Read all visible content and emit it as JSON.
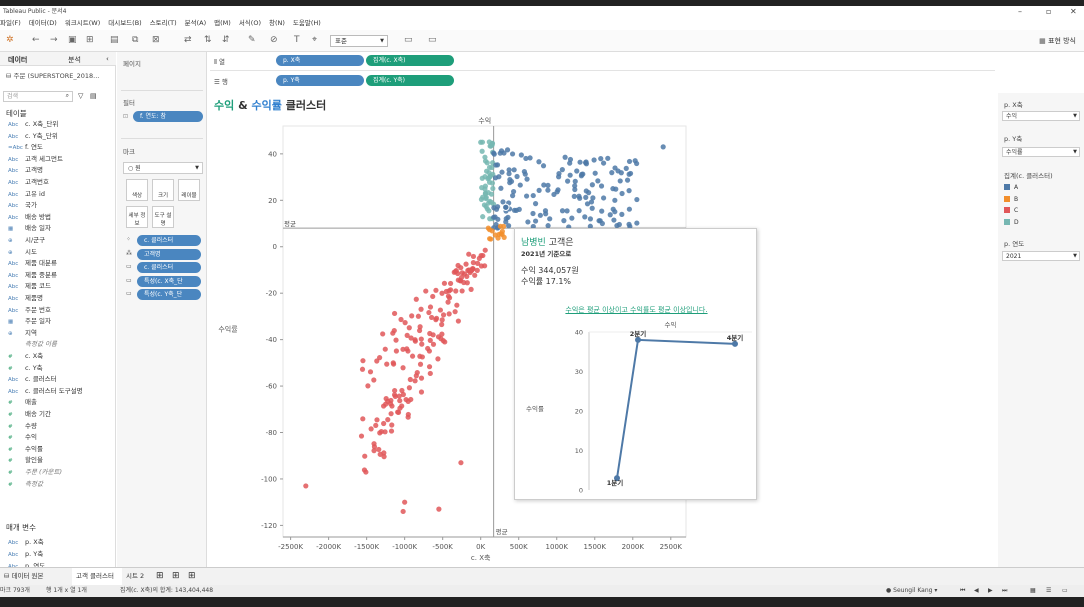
{
  "window": {
    "title": "Tableau Public - 문서4"
  },
  "menu": [
    "파일(F)",
    "데이터(D)",
    "워크시트(W)",
    "대시보드(B)",
    "스토리(T)",
    "분석(A)",
    "맵(M)",
    "서식(O)",
    "창(N)",
    "도움말(H)"
  ],
  "toolbar": {
    "dropdown_value": "표준",
    "show_me": "표현 방식"
  },
  "sidebar": {
    "tab_data": "데이터",
    "tab_analysis": "분석",
    "datasource": "주문 (SUPERSTORE_2018...",
    "search_placeholder": "검색",
    "tables_header": "테이블",
    "fields": [
      {
        "type": "Abc",
        "name": "c. X축_단위"
      },
      {
        "type": "Abc",
        "name": "c. Y축_단위"
      },
      {
        "type": "=Abc",
        "name": "f. 연도"
      },
      {
        "type": "Abc",
        "name": "고객 세그먼트"
      },
      {
        "type": "Abc",
        "name": "고객명"
      },
      {
        "type": "Abc",
        "name": "고객번호"
      },
      {
        "type": "Abc",
        "name": "고유 id"
      },
      {
        "type": "Abc",
        "name": "국가"
      },
      {
        "type": "Abc",
        "name": "배송 방법"
      },
      {
        "type": "▦",
        "name": "배송 일자"
      },
      {
        "type": "⊕",
        "name": "시/군구"
      },
      {
        "type": "⊕",
        "name": "시도"
      },
      {
        "type": "Abc",
        "name": "제품 대분류"
      },
      {
        "type": "Abc",
        "name": "제품 중분류"
      },
      {
        "type": "Abc",
        "name": "제품 코드"
      },
      {
        "type": "Abc",
        "name": "제품명"
      },
      {
        "type": "Abc",
        "name": "주문 번호"
      },
      {
        "type": "▦",
        "name": "주문 일자"
      },
      {
        "type": "⊕",
        "name": "지역"
      },
      {
        "type": "",
        "name": "측정값 이름"
      },
      {
        "type": "#",
        "name": "c. X축"
      },
      {
        "type": "#",
        "name": "c. Y축"
      },
      {
        "type": "Abc",
        "name": "c. 클러스터"
      },
      {
        "type": "Abc",
        "name": "c. 클러스터 도구설명"
      },
      {
        "type": "#",
        "name": "매출"
      },
      {
        "type": "#",
        "name": "배송 기간"
      },
      {
        "type": "#",
        "name": "수량"
      },
      {
        "type": "#",
        "name": "수익"
      },
      {
        "type": "#",
        "name": "수익률"
      },
      {
        "type": "#",
        "name": "할인율"
      },
      {
        "type": "#",
        "name": "주문 (카운트)"
      },
      {
        "type": "#",
        "name": "측정값"
      }
    ],
    "params_header": "매개 변수",
    "params": [
      {
        "type": "Abc",
        "name": "p. X축"
      },
      {
        "type": "Abc",
        "name": "p. Y축"
      },
      {
        "type": "Abc",
        "name": "p. 연도"
      }
    ]
  },
  "cards": {
    "pages": "페이지",
    "filters": "필터",
    "filter_pill": "f. 연도: 참",
    "marks": "마크",
    "mark_type": "원",
    "btn_color": "색상",
    "btn_size": "크기",
    "btn_label": "레이블",
    "btn_detail": "세부 정보",
    "btn_tooltip": "도구 설명",
    "mark_pills": [
      "c. 클러스터",
      "고객명",
      "c. 클러스터",
      "특성(c. X축_단",
      "특성(c. Y축_단"
    ]
  },
  "shelves": {
    "columns_label": "열",
    "rows_label": "행",
    "columns": [
      "p. X축",
      "집계(c. X축)"
    ],
    "rows": [
      "p. Y축",
      "집계(c. Y축)"
    ]
  },
  "chart_title": {
    "part1": "수익",
    "amp": " & ",
    "part2": "수익률",
    "part3": " 클러스터"
  },
  "chart_data": {
    "type": "scatter",
    "xlabel": "c. X축",
    "ylabel": "수익률",
    "top_label": "수익",
    "x_ticks": [
      "-2500K",
      "-2000K",
      "-1500K",
      "-1000K",
      "-500K",
      "0K",
      "500K",
      "1000K",
      "1500K",
      "2000K",
      "2500K"
    ],
    "y_ticks": [
      40,
      20,
      0,
      -20,
      -40,
      -60,
      -80,
      -100,
      -120
    ],
    "ref_line_label_h": "평균",
    "ref_line_label_v": "평균",
    "xlim": [
      -2600,
      2700
    ],
    "ylim": [
      -125,
      52
    ],
    "colors": {
      "A": "#4e79a7",
      "B": "#f28e2b",
      "C": "#e15759",
      "D": "#76b7b2"
    }
  },
  "tooltip": {
    "name": "남병빈",
    "name_suffix": " 고객은",
    "year_line": "2021년 기준으로",
    "profit_line": "수익 344,057원",
    "ratio_line": "수익률 17.1%",
    "message": "수익은 평균 이상이고 수익률도 평균 이상입니다.",
    "mini_chart": {
      "type": "line",
      "top_label": "수익",
      "ylabel": "수익률",
      "y_ticks": [
        40,
        30,
        20,
        10,
        0
      ],
      "points": [
        {
          "label": "1분기",
          "y": 3
        },
        {
          "label": "2분기",
          "y": 38
        },
        {
          "label": "4분기",
          "y": 37
        }
      ]
    }
  },
  "right_panel": {
    "px_label": "p. X축",
    "px_value": "수익",
    "py_label": "p. Y축",
    "py_value": "수익률",
    "legend_title": "집계(c. 클러스터)",
    "legend": [
      {
        "k": "A",
        "c": "#4e79a7"
      },
      {
        "k": "B",
        "c": "#f28e2b"
      },
      {
        "k": "C",
        "c": "#e15759"
      },
      {
        "k": "D",
        "c": "#76b7b2"
      }
    ],
    "year_label": "p. 연도",
    "year_value": "2021"
  },
  "sheet_tabs": [
    "데이터 원본",
    "고객 클러스터",
    "시트 2"
  ],
  "status": {
    "marks": "마크 793개",
    "rows": "행 1개 x 열 1개",
    "sum": "집계(c. X축)의 합계: 143,404,448",
    "user": "Seungil Kang"
  }
}
